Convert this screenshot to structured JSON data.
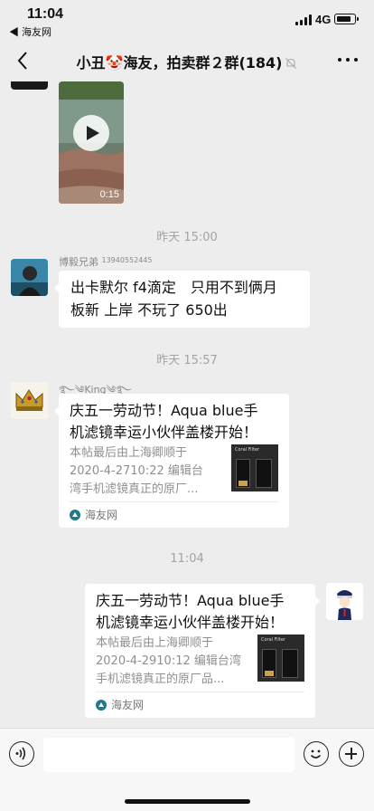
{
  "status_bar": {
    "time": "11:04",
    "back_app": "◀ 海友网",
    "network": "4G"
  },
  "nav": {
    "title": "小丑🤡海友，拍卖群２群(184)"
  },
  "video": {
    "duration": "0:15"
  },
  "messages": [
    {
      "timestamp": "昨天 15:00",
      "sender": "博毅兄弟",
      "sender_phone": "13940552445",
      "text_line1": "出卡默尔 f4滴定　只用不到俩月",
      "text_line2": "板新  上岸  不玩了  650出"
    },
    {
      "timestamp": "昨天 15:57",
      "sender": "࿐༄King༄࿐",
      "link_title_line1": "庆五一劳动节！Aqua blue手",
      "link_title_line2": "机滤镜幸运小伙伴盖楼开始！",
      "link_desc_line1": "本帖最后由上海卿顺于",
      "link_desc_line2": "2020-4-2710:22 编辑台",
      "link_desc_line3": "湾手机滤镜真正的原厂...",
      "source": "海友网",
      "thumb_label": "Coral Filter"
    },
    {
      "timestamp": "11:04",
      "link_title_line1": "庆五一劳动节！Aqua blue手",
      "link_title_line2": "机滤镜幸运小伙伴盖楼开始！",
      "link_desc_line1": "本帖最后由上海卿顺于",
      "link_desc_line2": "2020-4-2910:12 编辑台湾",
      "link_desc_line3": "手机滤镜真正的原厂品...",
      "source": "海友网",
      "thumb_label": "Coral Filter"
    }
  ],
  "icons": {
    "back": "chevron-left-icon",
    "mute": "bell-mute-icon",
    "more": "more-dots-icon",
    "play": "play-icon",
    "voice": "voice-icon",
    "emoji": "emoji-icon",
    "plus": "plus-icon"
  },
  "colors": {
    "background": "#ededed",
    "bubble": "#ffffff",
    "timestamp": "#a3a3a3"
  }
}
